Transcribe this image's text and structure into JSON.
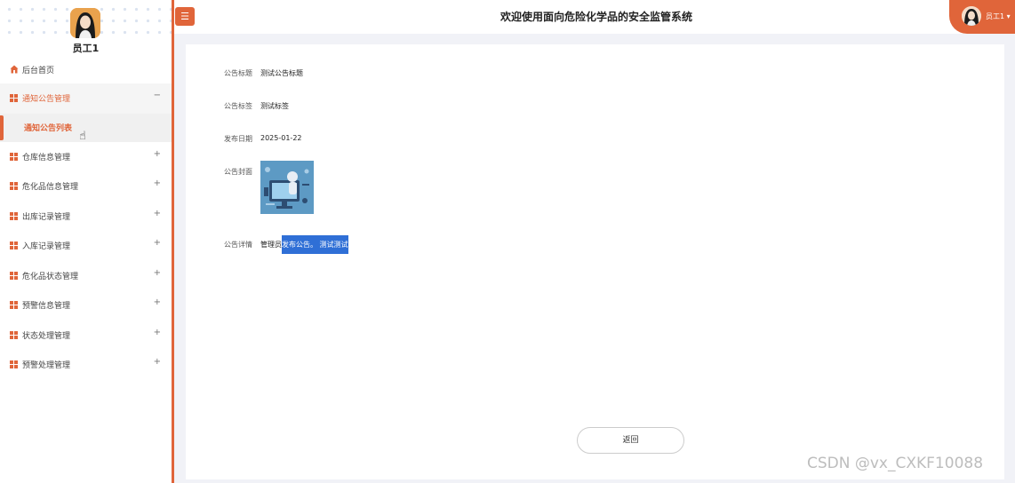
{
  "app": {
    "title": "欢迎使用面向危险化学品的安全监管系统"
  },
  "user": {
    "name": "员工1",
    "header_name": "员工1 ▾"
  },
  "sidebar": {
    "home": "后台首页",
    "items": [
      {
        "label": "通知公告管理",
        "sign": "−"
      },
      {
        "label": "仓库信息管理",
        "sign": "+"
      },
      {
        "label": "危化品信息管理",
        "sign": "+"
      },
      {
        "label": "出库记录管理",
        "sign": "+"
      },
      {
        "label": "入库记录管理",
        "sign": "+"
      },
      {
        "label": "危化品状态管理",
        "sign": "+"
      },
      {
        "label": "预警信息管理",
        "sign": "+"
      },
      {
        "label": "状态处理管理",
        "sign": "+"
      },
      {
        "label": "预警处理管理",
        "sign": "+"
      }
    ],
    "subitem": "通知公告列表"
  },
  "detail": {
    "title_label": "公告标题",
    "title_value": "测试公告标题",
    "tag_label": "公告标签",
    "tag_value": "测试标签",
    "date_label": "发布日期",
    "date_value": "2025-01-22",
    "cover_label": "公告封面",
    "content_label": "公告详情",
    "content_prefix": "管理员",
    "content_selected": "发布公告。 测试测试"
  },
  "buttons": {
    "return": "返回"
  },
  "watermark": "CSDN @vx_CXKF10088",
  "colors": {
    "accent": "#e0653a",
    "selection": "#2f6fd6"
  }
}
